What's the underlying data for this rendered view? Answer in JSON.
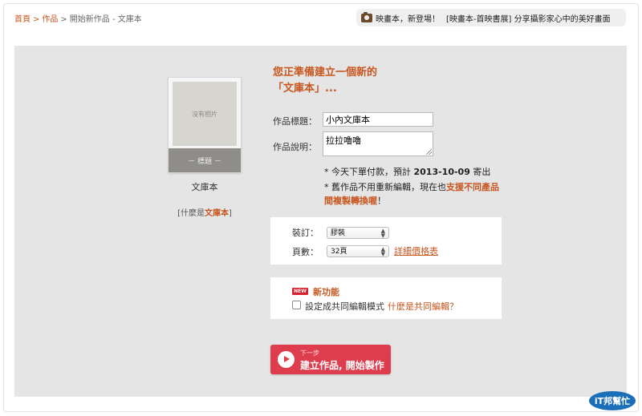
{
  "breadcrumb": {
    "home": "首頁",
    "works": "作品",
    "current": "開始新作品 - 文庫本",
    "sep": ">"
  },
  "announcement": {
    "text1": "映畫本，新登場！",
    "text2": "[映畫本-首映書展] 分享攝影家心中的美好畫面"
  },
  "book": {
    "no_photo": "沒有相片",
    "band_title": "－ 標題 －",
    "name": "文庫本",
    "what_prefix": "[什麼是",
    "what_link": "文庫本",
    "what_suffix": "]"
  },
  "heading": {
    "line1": "您正準備建立一個新的",
    "line2": "「文庫本」..."
  },
  "form": {
    "title_label": "作品標題：",
    "title_value": "小內文庫本",
    "desc_label": "作品說明：",
    "desc_value": "拉拉嚕嚕"
  },
  "notes": {
    "note1_prefix": "* 今天下單付款，預計 ",
    "note1_date": "2013-10-09",
    "note1_suffix": " 寄出",
    "note2_prefix": "* 舊作品不用重新編輯，現在也",
    "note2_link": "支援不同產品間複製轉換喔",
    "note2_suffix": "！"
  },
  "options": {
    "binding_label": "裝訂：",
    "binding_value": "膠裝",
    "pages_label": "頁數：",
    "pages_value": "32頁",
    "price_link": "詳細價格表"
  },
  "feature": {
    "badge": "NEW",
    "title": "新功能",
    "checkbox_label": "設定成共同編輯模式",
    "help_link": "什麼是共同編輯？"
  },
  "next_button": {
    "small": "下一步",
    "main": "建立作品, 開始製作"
  },
  "logo": {
    "text": "iT邦幫忙"
  }
}
